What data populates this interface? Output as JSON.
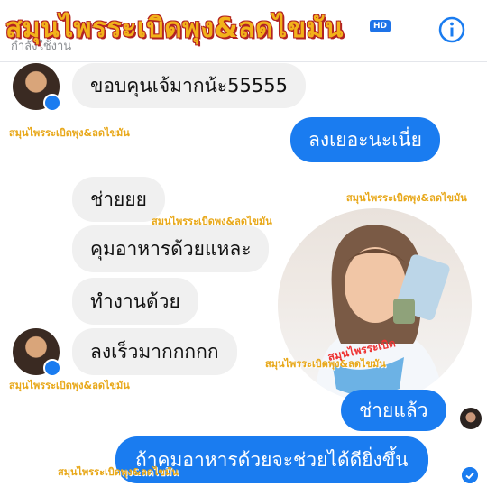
{
  "header": {
    "banner": "สมุนไพรระเบิดพุง&ลดไขมัน",
    "status": "กำลังใช้งาน",
    "hd_badge": "HD"
  },
  "messages": [
    {
      "side": "in",
      "text": "ขอบคุนเจ้มากน้ะ55555"
    },
    {
      "side": "out",
      "text": "ลงเยอะนะเนี่ย"
    },
    {
      "side": "in",
      "text": "ช่ายยย"
    },
    {
      "side": "in",
      "text": "คุมอาหารด้วยแหละ"
    },
    {
      "side": "in",
      "text": "ทำงานด้วย"
    },
    {
      "side": "in",
      "text": "ลงเร็วมากกกกก"
    },
    {
      "side": "out",
      "text": "ช่ายแล้ว"
    },
    {
      "side": "out",
      "text": "ถ้าคุมอาหารด้วยจะช่วยได้ดียิ่งขึ้น"
    }
  ],
  "watermark": "สมุนไพรระเบิดพุง&ลดไขมัน",
  "photo_caption": "สมุนไพรระเบิด",
  "colors": {
    "accent": "#1a7cf0",
    "incoming_bubble": "#f0f0f0",
    "banner": "#f2b21a"
  }
}
